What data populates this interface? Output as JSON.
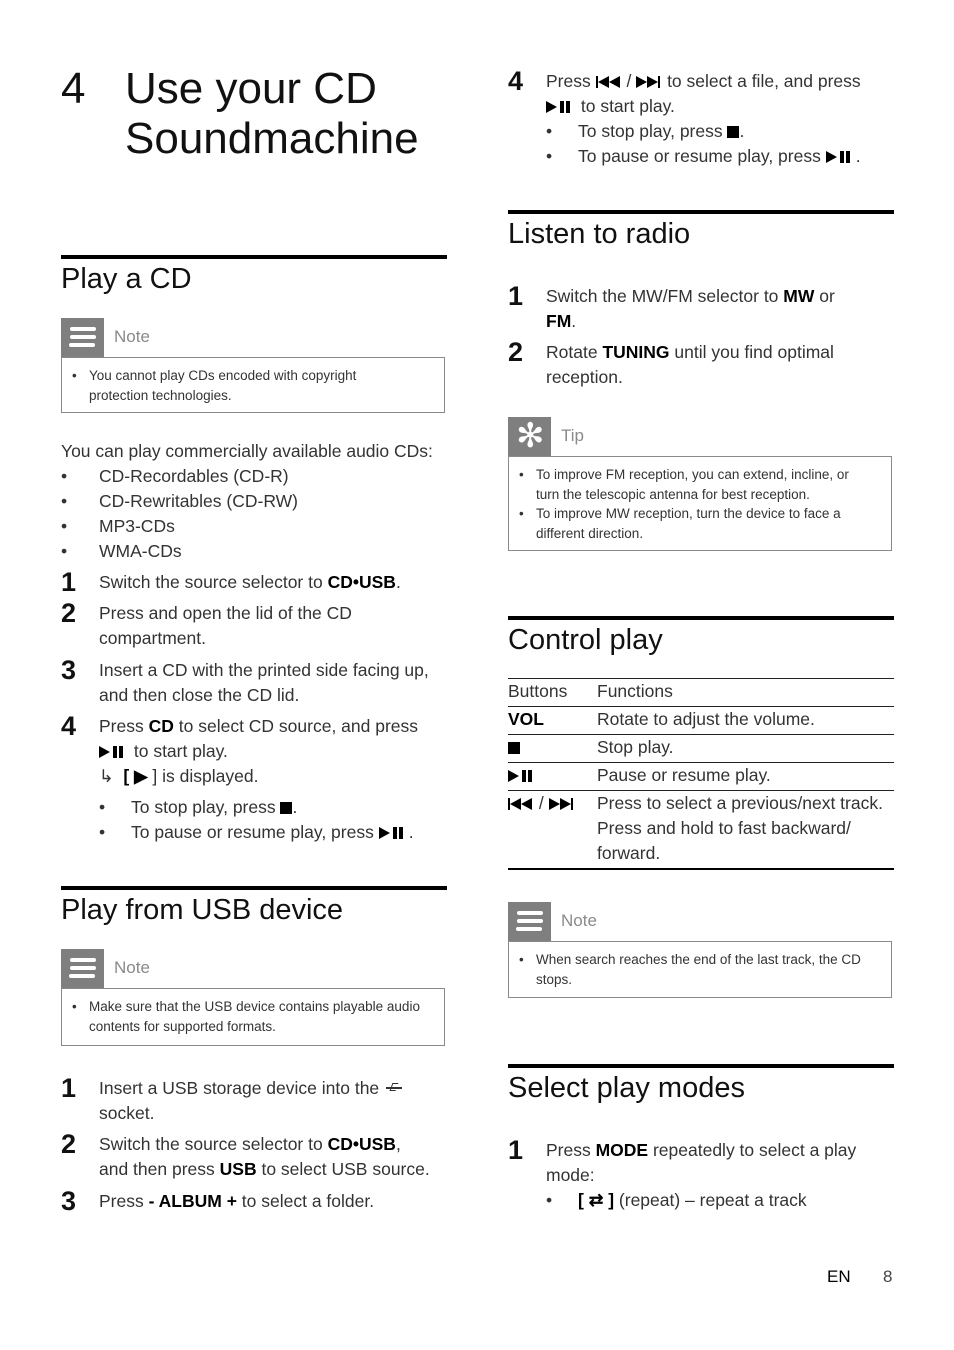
{
  "chapter": {
    "number": "4",
    "title_line1": "Use your CD",
    "title_line2": "Soundmachine"
  },
  "play_cd": {
    "title": "Play a CD",
    "note": {
      "label": "Note",
      "items": [
        "You cannot play CDs encoded with copyright protection technologies."
      ]
    },
    "intro": "You can play commercially available audio CDs:",
    "formats": [
      "CD-Recordables (CD-R)",
      "CD-Rewritables (CD-RW)",
      "MP3-CDs",
      "WMA-CDs"
    ],
    "steps": [
      {
        "num": "1",
        "pre": "Switch the source selector to ",
        "bold": "CD•USB",
        "post": "."
      },
      {
        "num": "2",
        "text": "Press and open the lid of the CD compartment."
      },
      {
        "num": "3",
        "text": "Insert a CD with the printed side facing up, and then close the CD lid."
      },
      {
        "num": "4",
        "pre": "Press ",
        "bold": "CD",
        "post": " to select CD source, and press",
        "line2": " to start play.",
        "result": "] is displayed.",
        "result_open": "[ ▶ "
      }
    ],
    "bullets": [
      {
        "text": "To stop play, press ",
        "icon": "stop"
      },
      {
        "text": "To pause or resume play, press ",
        "icon": "play-pause"
      }
    ]
  },
  "play_usb": {
    "title": "Play from USB device",
    "note": {
      "label": "Note",
      "items": [
        "Make sure that the USB device contains playable audio contents for supported formats."
      ]
    },
    "steps": [
      {
        "num": "1",
        "text": "Insert a USB storage device into the",
        "line2": "socket."
      },
      {
        "num": "2",
        "pre": "Switch the source selector to ",
        "bold": "CD•USB",
        "post": ",",
        "line2_pre": "and then press ",
        "line2_bold": "USB",
        "line2_post": " to select USB source."
      },
      {
        "num": "3",
        "pre": "Press ",
        "bold": "- ALBUM +",
        "post": " to select a folder."
      },
      {
        "num": "4",
        "pre": "Press ",
        "mid": " / ",
        "post": " to select a file, and press",
        "line2": " to start play."
      }
    ],
    "bullets": [
      {
        "text": "To stop play, press ",
        "icon": "stop"
      },
      {
        "text": "To pause or resume play, press ",
        "icon": "play-pause"
      }
    ]
  },
  "radio": {
    "title": "Listen to radio",
    "steps": [
      {
        "num": "1",
        "pre": "Switch the MW/FM selector to ",
        "bold": "MW",
        "post": " or",
        "line2_bold": "FM",
        "line2_post": "."
      },
      {
        "num": "2",
        "pre": "Rotate ",
        "bold": "TUNING",
        "post": " until you find optimal",
        "line2": "reception."
      }
    ],
    "tip": {
      "label": "Tip",
      "items": [
        "To improve FM reception, you can extend, incline, or turn the telescopic antenna for best reception.",
        "To improve MW reception, turn the device to face a different direction."
      ]
    }
  },
  "control_play": {
    "title": "Control play",
    "headers": [
      "Buttons",
      "Functions"
    ],
    "rows": [
      {
        "button": "VOL",
        "function": "Rotate to adjust the volume."
      },
      {
        "button_icon": "stop",
        "function": "Stop play."
      },
      {
        "button_icon": "play-pause",
        "function": "Pause or resume play."
      },
      {
        "button_icon": "prev-next",
        "function": "Press to select a previous/next track. Press and hold to fast backward/ forward."
      }
    ],
    "note": {
      "label": "Note",
      "items": [
        "When search reaches the end of the last track, the CD stops."
      ]
    }
  },
  "play_modes": {
    "title": "Select play modes",
    "steps": [
      {
        "num": "1",
        "pre": "Press ",
        "bold": "MODE",
        "post": " repeatedly to select a play",
        "line2": "mode:"
      }
    ],
    "bullets": [
      {
        "bold": "[ ⇄ ]",
        "text": " (repeat) – repeat a track"
      }
    ]
  },
  "footer": {
    "lang": "EN",
    "page": "8"
  }
}
